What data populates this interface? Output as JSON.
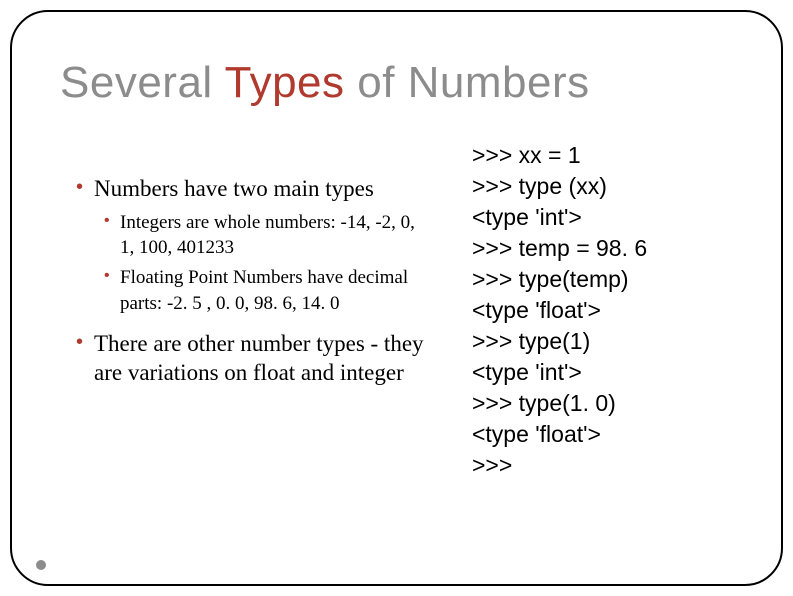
{
  "title": {
    "pre": "Several ",
    "accent": "Types",
    "post": " of Numbers"
  },
  "bullets": {
    "main1": "Numbers have two main types",
    "sub1": "Integers are whole numbers: -14, -2, 0, 1, 100, 401233",
    "sub2": "Floating Point Numbers have decimal parts:  -2. 5 , 0. 0, 98. 6, 14. 0",
    "main2": "There are other number types - they are variations on float and integer"
  },
  "code": {
    "l1": ">>> xx = 1",
    "l2": ">>> type (xx)",
    "l3": "<type 'int'>",
    "l4": ">>> temp = 98. 6",
    "l5": ">>> type(temp)",
    "l6": "<type 'float'>",
    "l7": ">>> type(1)",
    "l8": "<type 'int'>",
    "l9": ">>> type(1. 0)",
    "l10": "<type 'float'>",
    "l11": ">>>"
  }
}
